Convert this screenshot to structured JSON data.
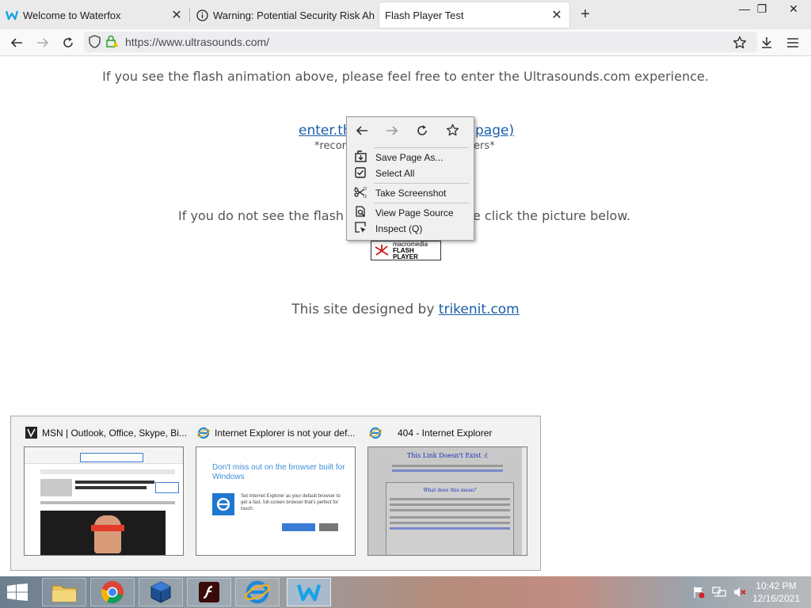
{
  "tabs": [
    {
      "title": "Welcome to Waterfox",
      "icon": "waterfox-icon",
      "close": "✕"
    },
    {
      "title": "Warning: Potential Security Risk Ah",
      "icon": "info-icon",
      "close": "✕"
    },
    {
      "title": "Flash Player Test",
      "icon": "none",
      "close": "✕"
    }
  ],
  "window_controls": {
    "minimize": "—",
    "restore": "❐",
    "close": "✕"
  },
  "new_tab": "+",
  "navbar": {
    "url": "https://www.ultrasounds.com/"
  },
  "content": {
    "line1": "If you see the flash animation above, please feel free to enter the Ultrasounds.com experience.",
    "enter_link_left": "enter.th",
    "enter_link_right": "page)",
    "recommend_left": "*recom",
    "recommend_right": "ers*",
    "line3_left": "If you do not see the flash",
    "line3_right": "e click the picture below.",
    "flash_logo_line1": "macromedia",
    "flash_logo_line2": "FLASH",
    "flash_logo_line3": "PLAYER",
    "designed_by": "This site designed by ",
    "designed_link": "trikenit.com"
  },
  "context_menu": {
    "items": [
      {
        "label": "Save Page As...",
        "icon": "save-page-icon"
      },
      {
        "label": "Select All",
        "icon": "select-all-icon"
      },
      {
        "label": "Take Screenshot",
        "icon": "screenshot-icon"
      },
      {
        "label": "View Page Source",
        "icon": "page-source-icon"
      },
      {
        "label": "Inspect (Q)",
        "icon": "inspect-icon"
      }
    ]
  },
  "taskbar_preview": {
    "windows": [
      {
        "title": "MSN | Outlook, Office, Skype, Bi..."
      },
      {
        "title": "Internet Explorer is not your def...",
        "body_heading": "Don't miss out on the browser built for Windows",
        "body_text": "Set Internet Explorer as your default browser to get a fast, full-screen browser that's perfect for touch."
      },
      {
        "title": "404 - Internet Explorer",
        "body_heading": "This Link Doesn't Exist :(",
        "body_sub": "What does this mean?"
      }
    ]
  },
  "clock": {
    "time": "10:42 PM",
    "date": "12/16/2021"
  },
  "colors": {
    "accent_link": "#1a5ea8",
    "tab_bg": "#eaeaea",
    "menu_bg": "#f0f0f0"
  }
}
